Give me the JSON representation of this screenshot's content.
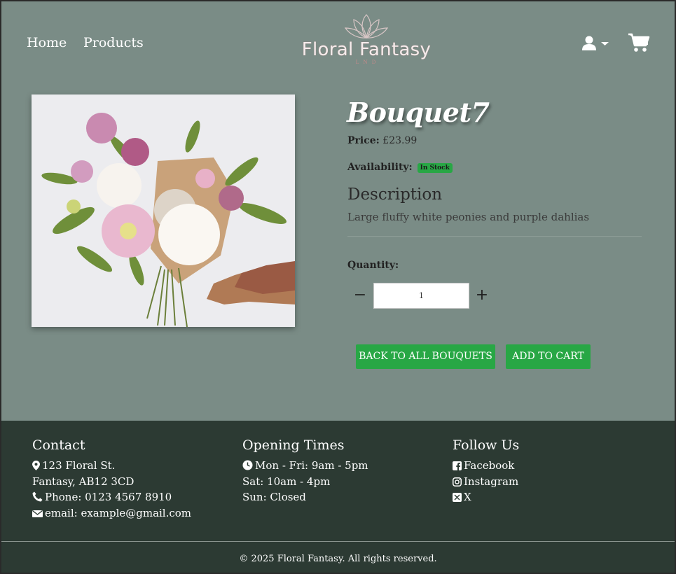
{
  "nav": {
    "home": "Home",
    "products": "Products"
  },
  "logo": {
    "title": "Floral Fantasy",
    "subtitle": "L N D"
  },
  "icons": {
    "user": "user-icon",
    "caret": "caret-down-icon",
    "cart": "shopping-cart-icon"
  },
  "product": {
    "title": "Bouquet7",
    "price_label": "Price:",
    "price": "£23.99",
    "availability_label": "Availability:",
    "availability": "In Stock",
    "description_heading": "Description",
    "description": "Large fluffy white peonies and purple dahlias",
    "quantity_label": "Quantity:",
    "quantity": "1",
    "minus": "−",
    "plus": "+",
    "back_button": "BACK TO ALL BOUQUETS",
    "add_button": "ADD TO CART"
  },
  "footer": {
    "contact": {
      "heading": "Contact",
      "address1": "123 Floral St.",
      "address2": "Fantasy, AB12 3CD",
      "phone": "Phone: 0123 4567 8910",
      "email": "email: example@gmail.com"
    },
    "hours": {
      "heading": "Opening Times",
      "weekdays": "Mon - Fri: 9am - 5pm",
      "saturday": "Sat: 10am - 4pm",
      "sunday": "Sun: Closed"
    },
    "social": {
      "heading": "Follow Us",
      "facebook": "Facebook",
      "instagram": "Instagram",
      "x": "X"
    },
    "copyright": "© 2025 Floral Fantasy. All rights reserved."
  },
  "colors": {
    "main_bg": "#7a8c86",
    "footer_bg": "#2c3a33",
    "accent": "#28a745"
  }
}
